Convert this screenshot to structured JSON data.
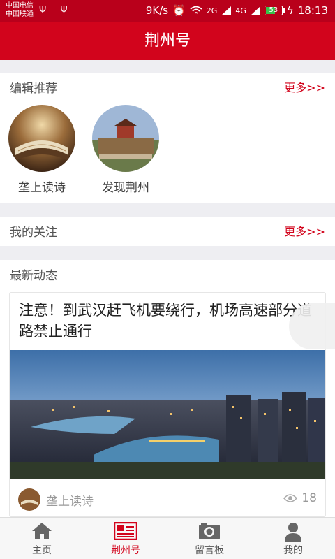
{
  "status_bar": {
    "carrier1": "中国电信",
    "carrier2": "中国联通",
    "speed": "9K/s",
    "network1": "2G",
    "network2": "4G",
    "battery": "53",
    "time": "18:13"
  },
  "header": {
    "title": "荆州号"
  },
  "editor_picks": {
    "title": "编辑推荐",
    "more": "更多>>",
    "items": [
      {
        "label": "垄上读诗"
      },
      {
        "label": "发现荆州"
      }
    ]
  },
  "following": {
    "title": "我的关注",
    "more": "更多>>"
  },
  "latest": {
    "title": "最新动态",
    "card": {
      "title": "注意！到武汉赶飞机要绕行，机场高速部分道路禁止通行",
      "author": "垄上读诗",
      "views": "18"
    }
  },
  "tabs": [
    {
      "label": "主页",
      "icon": "home-icon"
    },
    {
      "label": "荆州号",
      "icon": "newspaper-icon",
      "active": true
    },
    {
      "label": "留言板",
      "icon": "camera-icon"
    },
    {
      "label": "我的",
      "icon": "person-icon"
    }
  ],
  "colors": {
    "brand": "#d2041c",
    "status_bar": "#b9001b"
  }
}
